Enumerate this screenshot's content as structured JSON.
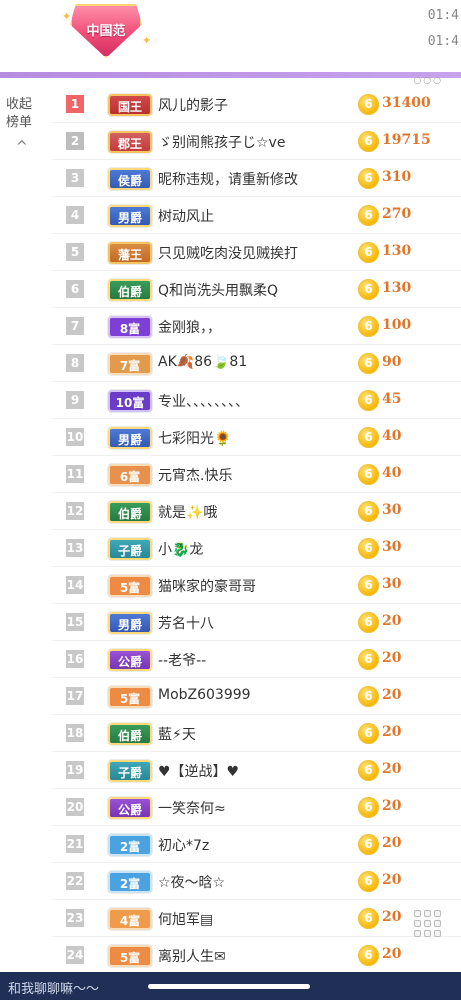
{
  "header": {
    "badge_text": "中国范",
    "time1": "01:4",
    "time2": "01:4",
    "more_dots": "○○○"
  },
  "collapse": {
    "line1": "收起",
    "line2": "榜单",
    "chevron": "^"
  },
  "rows": [
    {
      "rank": "1",
      "title": "国王",
      "title_class": "t-king",
      "name": "风儿的影子",
      "score": "31400"
    },
    {
      "rank": "2",
      "title": "郡王",
      "title_class": "t-jun",
      "name": "ゞ别闹熊孩子じ☆ve",
      "score": "19715"
    },
    {
      "rank": "3",
      "title": "侯爵",
      "title_class": "t-hou",
      "name": "昵称违规，请重新修改",
      "score": "310"
    },
    {
      "rank": "4",
      "title": "男爵",
      "title_class": "t-nan",
      "name": "树动风止",
      "score": "270"
    },
    {
      "rank": "5",
      "title": "藩王",
      "title_class": "t-fan",
      "name": "只见贼吃肉没见贼挨打",
      "score": "130"
    },
    {
      "rank": "6",
      "title": "伯爵",
      "title_class": "t-bo",
      "name": "Q和尚洗头用飘柔Q",
      "score": "130"
    },
    {
      "rank": "7",
      "title": "8富",
      "title_class": "t-fu8",
      "name": "金刚狼，，",
      "score": "100"
    },
    {
      "rank": "8",
      "title": "7富",
      "title_class": "t-fu7",
      "name": "AK🍂86🍃81",
      "score": "90"
    },
    {
      "rank": "9",
      "title": "10富",
      "title_class": "t-fu10",
      "name": "专业、、、、、、、、",
      "score": "45"
    },
    {
      "rank": "10",
      "title": "男爵",
      "title_class": "t-nan",
      "name": "七彩阳光🌻",
      "score": "40"
    },
    {
      "rank": "11",
      "title": "6富",
      "title_class": "t-fu6",
      "name": "元宵杰.快乐",
      "score": "40"
    },
    {
      "rank": "12",
      "title": "伯爵",
      "title_class": "t-bo",
      "name": "就是✨哦",
      "score": "30"
    },
    {
      "rank": "13",
      "title": "子爵",
      "title_class": "t-zi",
      "name": "小🐉龙",
      "score": "30"
    },
    {
      "rank": "14",
      "title": "5富",
      "title_class": "t-fu5",
      "name": "猫咪家的豪哥哥",
      "score": "30"
    },
    {
      "rank": "15",
      "title": "男爵",
      "title_class": "t-nan",
      "name": "芳名十八",
      "score": "20"
    },
    {
      "rank": "16",
      "title": "公爵",
      "title_class": "t-gong",
      "name": "--老爷--",
      "score": "20"
    },
    {
      "rank": "17",
      "title": "5富",
      "title_class": "t-fu5",
      "name": "MobZ603999",
      "score": "20"
    },
    {
      "rank": "18",
      "title": "伯爵",
      "title_class": "t-bo",
      "name": "藍⚡天",
      "score": "20"
    },
    {
      "rank": "19",
      "title": "子爵",
      "title_class": "t-zi",
      "name": "♥【逆战】♥",
      "score": "20"
    },
    {
      "rank": "20",
      "title": "公爵",
      "title_class": "t-gong",
      "name": "一笑奈何≈",
      "score": "20"
    },
    {
      "rank": "21",
      "title": "2富",
      "title_class": "t-fu2",
      "name": "初心*7z",
      "score": "20"
    },
    {
      "rank": "22",
      "title": "2富",
      "title_class": "t-fu2",
      "name": "☆夜～晗☆",
      "score": "20"
    },
    {
      "rank": "23",
      "title": "4富",
      "title_class": "t-fu4",
      "name": "何旭军▤",
      "score": "20"
    },
    {
      "rank": "24",
      "title": "5富",
      "title_class": "t-fu5",
      "name": "离别人生✉",
      "score": "20"
    }
  ],
  "coin_glyph": "6",
  "footer": {
    "chat_hint": "和我聊聊嘛～～"
  }
}
